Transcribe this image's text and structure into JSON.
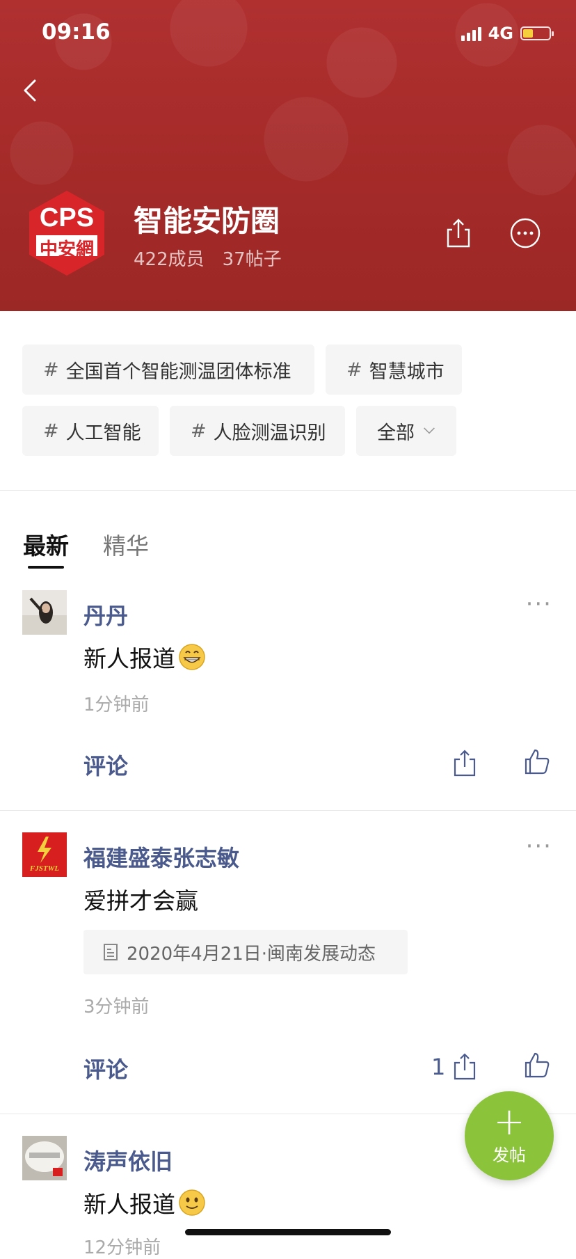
{
  "status_bar": {
    "time": "09:16",
    "network": "4G"
  },
  "group": {
    "logo_text_top": "CPS",
    "logo_text_bottom": "中安網",
    "title": "智能安防圈",
    "members": "422成员",
    "posts": "37帖子"
  },
  "tags": [
    {
      "hash": "#",
      "label": "全国首个智能测温团体标准"
    },
    {
      "hash": "#",
      "label": "智慧城市"
    },
    {
      "hash": "#",
      "label": "人工智能"
    },
    {
      "hash": "#",
      "label": "人脸测温识别"
    },
    {
      "label": "全部"
    }
  ],
  "tabs": [
    {
      "label": "最新"
    },
    {
      "label": "精华"
    }
  ],
  "posts": [
    {
      "author": "丹丹",
      "content": "新人报道",
      "time_ago": "1分钟前",
      "comment_label": "评论",
      "share_count": ""
    },
    {
      "author": "福建盛泰张志敏",
      "avatar_text": "FJSTWL",
      "content": "爱拼才会赢",
      "link_card": "2020年4月21日·闽南发展动态",
      "time_ago": "3分钟前",
      "comment_label": "评论",
      "share_count": "1"
    },
    {
      "author": "涛声依旧",
      "content": "新人报道",
      "time_ago": "12分钟前"
    }
  ],
  "fab": {
    "plus": "+",
    "label": "发帖"
  },
  "colors": {
    "header_bg": "#a52a2a",
    "author_link": "#4a5a8c",
    "fab_green": "#8bc43b",
    "battery_fill": "#f6cf3c"
  },
  "icons": [
    "back-arrow-icon",
    "share-icon",
    "more-circle-icon",
    "chevron-down-icon",
    "thumbs-up-icon",
    "document-icon",
    "ellipsis-icon"
  ]
}
